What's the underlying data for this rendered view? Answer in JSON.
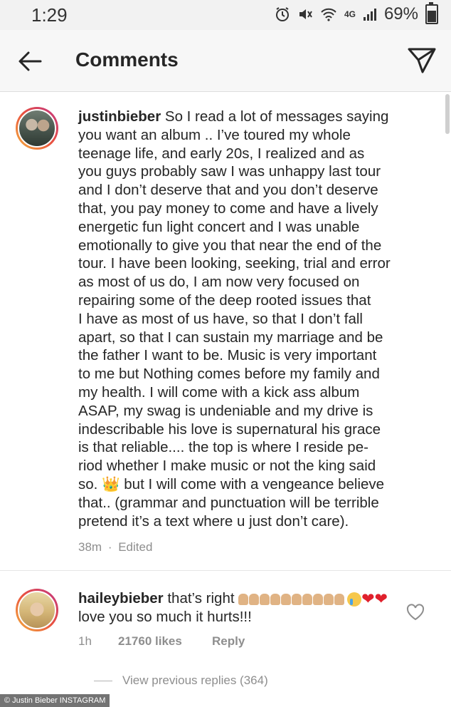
{
  "status_bar": {
    "time": "1:29",
    "network": "4G",
    "battery": "69%"
  },
  "header": {
    "title": "Comments"
  },
  "main_comment": {
    "username": "justinbieber",
    "lines": [
      "So I read a lot of messages saying",
      "you want an album .. I’ve toured my whole",
      "teenage life, and early 20s, I realized and as",
      "you guys probably saw I was unhappy last tour",
      "and I don’t deserve that and you don’t deserve",
      "that, you pay money to come and have a lively",
      "energetic fun light concert and I was unable",
      "emotionally to give you that near the end of the",
      "tour. I have been looking, seeking, trial and error",
      "as most of us do, I am now very focused on",
      "repairing some of the deep rooted issues that",
      "I have as most of us have, so that I don’t fall",
      "apart, so that I can sustain my marriage and be",
      "the father I want to be. Music is very important",
      "to me but Nothing comes before my family and",
      "my health. I will come with a kick ass album",
      "ASAP, my swag is undeniable and my drive is",
      "indescribable his love is supernatural his grace",
      "is that reliable.... the top is where I reside pe-",
      "riod whether I make music or not the king said",
      "so. 👑  but I will come with a vengeance believe",
      "that.. (grammar and punctuation will be terrible",
      "pretend it’s a text where u just don’t care)."
    ],
    "time": "38m",
    "separator": "·",
    "edited": "Edited"
  },
  "reply": {
    "username": "haileybieber",
    "text_line1": "that’s right",
    "text_line2": "love you so much it hurts!!!",
    "hearts": "❤❤",
    "time": "1h",
    "likes": "21760 likes",
    "reply_label": "Reply"
  },
  "view_previous": "View previous replies (364)",
  "watermark": "© Justin Bieber INSTAGRAM"
}
